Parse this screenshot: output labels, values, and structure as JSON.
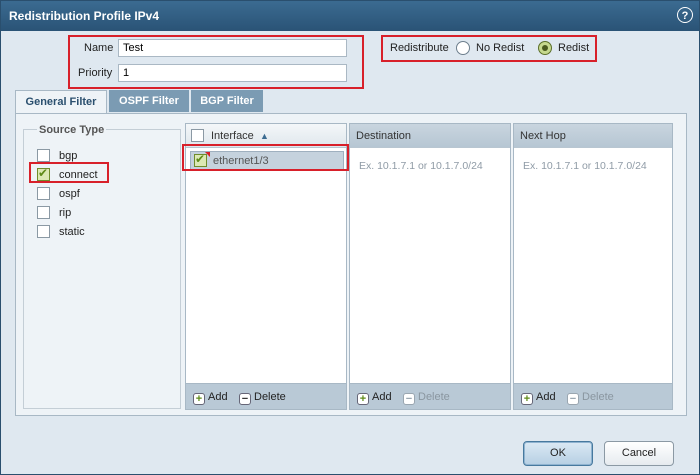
{
  "dialog": {
    "title": "Redistribution Profile IPv4"
  },
  "form": {
    "name_label": "Name",
    "name_value": "Test",
    "priority_label": "Priority",
    "priority_value": "1"
  },
  "redistribute": {
    "label": "Redistribute",
    "options": [
      {
        "label": "No Redist",
        "selected": false
      },
      {
        "label": "Redist",
        "selected": true
      }
    ]
  },
  "tabs": [
    {
      "label": "General Filter",
      "active": true
    },
    {
      "label": "OSPF Filter",
      "active": false
    },
    {
      "label": "BGP Filter",
      "active": false
    }
  ],
  "source_type": {
    "legend": "Source Type",
    "items": [
      {
        "label": "bgp",
        "checked": false
      },
      {
        "label": "connect",
        "checked": true
      },
      {
        "label": "ospf",
        "checked": false
      },
      {
        "label": "rip",
        "checked": false
      },
      {
        "label": "static",
        "checked": false
      }
    ]
  },
  "interface_grid": {
    "header": "Interface",
    "sort_icon": "sort-ascending-icon",
    "rows": [
      {
        "value": "ethernet1/3",
        "checked": true
      }
    ],
    "add": "Add",
    "delete": "Delete"
  },
  "destination_grid": {
    "header": "Destination",
    "placeholder": "Ex. 10.1.7.1 or 10.1.7.0/24",
    "add": "Add",
    "delete": "Delete"
  },
  "nexthop_grid": {
    "header": "Next Hop",
    "placeholder": "Ex. 10.1.7.1 or 10.1.7.0/24",
    "add": "Add",
    "delete": "Delete"
  },
  "buttons": {
    "ok": "OK",
    "cancel": "Cancel"
  },
  "colors": {
    "titlebar": "#2f5a7f",
    "highlight": "#d8202a",
    "check": "#5e8a17"
  }
}
